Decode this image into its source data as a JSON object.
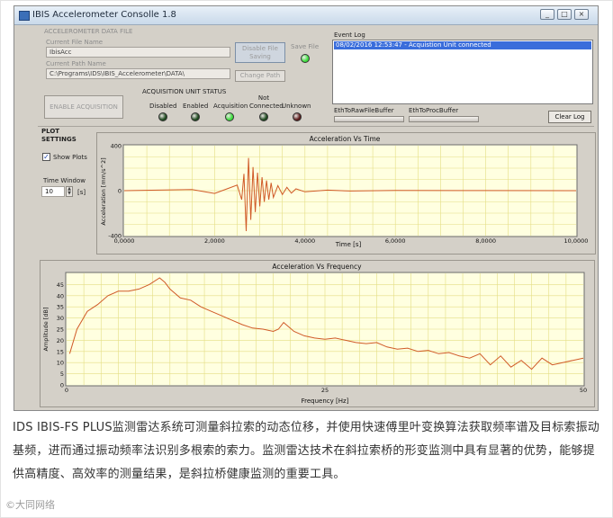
{
  "window": {
    "title": "IBIS Accelerometer Consolle 1.8",
    "minimize_glyph": "_",
    "maximize_glyph": "□",
    "close_glyph": "×"
  },
  "data_file": {
    "group_label": "ACCELEROMETER DATA FILE",
    "current_file_name_label": "Current File Name",
    "current_file_name_value": "IbisAcc",
    "current_path_label": "Current Path Name",
    "current_path_value": "C:\\Programs\\IDS\\IBIS_Accelerometer\\DATA\\",
    "disable_file_save_label": "Disable File Saving",
    "save_file_label": "Save File",
    "change_path_label": "Change Path",
    "enable_acquisition_label": "ENABLE ACQUISITION"
  },
  "unit_status": {
    "group_label": "ACQUISITION UNIT STATUS",
    "items": [
      {
        "label": "Disabled",
        "color": "#1f4a1f"
      },
      {
        "label": "Enabled",
        "color": "#1f4a1f"
      },
      {
        "label": "Acquisition",
        "color": "#3cdc3c"
      },
      {
        "label": "Not Connected",
        "color": "#1f4a1f"
      },
      {
        "label": "Unknown",
        "color": "#5a1a1a"
      }
    ],
    "save_led_color": "#3cdc3c"
  },
  "event_log": {
    "label": "Event Log",
    "entries": [
      "08/02/2016 12:53:47 - Acquistion Unit connected"
    ],
    "buffer_raw_label": "EthToRawFileBuffer",
    "buffer_proc_label": "EthToProcBuffer",
    "clear_log_label": "Clear Log"
  },
  "plot_settings": {
    "label": "PLOT SETTINGS",
    "show_plots_label": "Show Plots",
    "show_plots_checked": true,
    "time_window_label": "Time Window",
    "time_window_value": "10",
    "time_window_unit": "[s]"
  },
  "chart_data": [
    {
      "type": "line",
      "title": "Acceleration Vs Time",
      "xlabel": "Time [s]",
      "ylabel": "Acceleration [mm/s^2]",
      "xlim": [
        0,
        10
      ],
      "ylim": [
        -400,
        400
      ],
      "xticks": [
        "0,0000",
        "2,0000",
        "4,0000",
        "6,0000",
        "8,0000",
        "10,0000"
      ],
      "yticks": [
        "400",
        "0",
        "-400"
      ],
      "grid": true,
      "color": "#d05a28",
      "x": [
        0.0,
        1.5,
        2.0,
        2.5,
        2.6,
        2.65,
        2.7,
        2.75,
        2.8,
        2.85,
        2.9,
        2.95,
        3.0,
        3.05,
        3.1,
        3.15,
        3.2,
        3.25,
        3.3,
        3.4,
        3.5,
        3.6,
        3.7,
        3.8,
        4.0,
        4.5,
        5.0,
        6.0,
        8.0,
        10.0
      ],
      "y": [
        0,
        10,
        -25,
        50,
        -80,
        150,
        -360,
        290,
        -260,
        210,
        -190,
        160,
        -140,
        120,
        -100,
        90,
        -80,
        70,
        -60,
        45,
        -35,
        30,
        -22,
        16,
        -10,
        5,
        -3,
        2,
        1,
        0
      ]
    },
    {
      "type": "line",
      "title": "Acceleration Vs Frequency",
      "xlabel": "Frequency [Hz]",
      "ylabel": "Amplitude [dB]",
      "xlim": [
        0,
        50
      ],
      "ylim": [
        0,
        50
      ],
      "xticks": [
        "0",
        "25",
        "50"
      ],
      "yticks": [
        "0",
        "5",
        "10",
        "15",
        "20",
        "25",
        "30",
        "35",
        "40",
        "45"
      ],
      "grid": true,
      "color": "#d05a28",
      "x": [
        0.3,
        1,
        2,
        3,
        4,
        5,
        6,
        7,
        8,
        9,
        9.5,
        10,
        11,
        12,
        13,
        14,
        15,
        16,
        17,
        18,
        19,
        20,
        20.5,
        21,
        22,
        23,
        24,
        25,
        26,
        27,
        28,
        29,
        30,
        31,
        32,
        33,
        34,
        35,
        36,
        37,
        38,
        39,
        40,
        41,
        42,
        43,
        44,
        45,
        46,
        47,
        48,
        49,
        50
      ],
      "y": [
        14,
        25,
        33,
        36,
        40,
        42,
        42,
        43,
        45,
        48,
        46,
        43,
        39,
        38,
        35,
        33,
        31,
        29,
        27,
        25.5,
        25,
        24,
        25,
        28,
        24,
        22,
        21,
        20.5,
        21,
        20,
        19,
        18.5,
        19,
        17,
        16,
        16.5,
        15,
        15.5,
        14,
        14.5,
        13,
        12,
        14,
        9,
        13,
        8,
        11,
        7,
        12,
        9,
        10,
        11,
        12
      ]
    }
  ],
  "caption": {
    "text": "IDS IBIS-FS PLUS监测雷达系统可测量斜拉索的动态位移，并使用快速傅里叶变换算法获取频率谱及目标索振动基频，进而通过振动频率法识别多根索的索力。监测雷达技术在斜拉索桥的形变监测中具有显著的优势，能够提供高精度、高效率的测量结果，是斜拉桥健康监测的重要工具。",
    "watermark": "©大同网络"
  }
}
